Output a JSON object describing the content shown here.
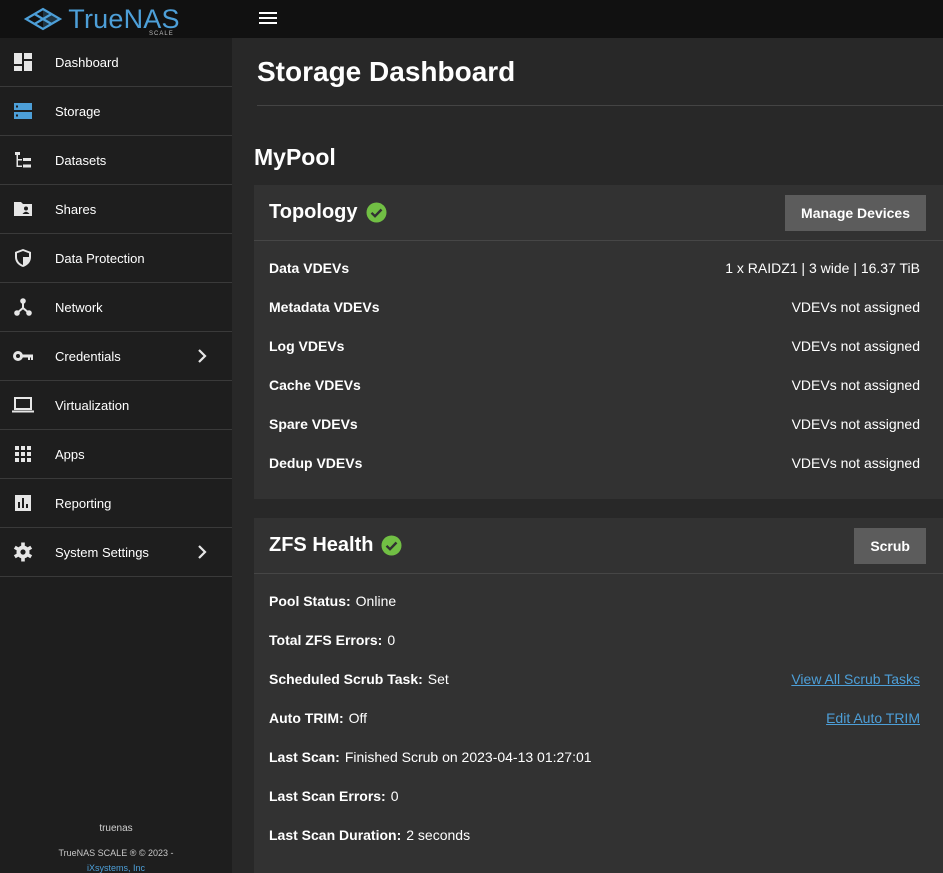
{
  "brand": {
    "name": "TrueNAS",
    "edition": "SCALE"
  },
  "sidebar": {
    "items": [
      {
        "label": "Dashboard",
        "icon": "dashboard-icon"
      },
      {
        "label": "Storage",
        "icon": "storage-icon"
      },
      {
        "label": "Datasets",
        "icon": "datasets-icon"
      },
      {
        "label": "Shares",
        "icon": "shares-folder-icon"
      },
      {
        "label": "Data Protection",
        "icon": "shield-icon"
      },
      {
        "label": "Network",
        "icon": "network-icon"
      },
      {
        "label": "Credentials",
        "icon": "key-icon"
      },
      {
        "label": "Virtualization",
        "icon": "laptop-icon"
      },
      {
        "label": "Apps",
        "icon": "apps-grid-icon"
      },
      {
        "label": "Reporting",
        "icon": "reporting-chart-icon"
      },
      {
        "label": "System Settings",
        "icon": "gear-icon"
      }
    ],
    "footer": {
      "hostname": "truenas",
      "copyright": "TrueNAS SCALE ® © 2023 -",
      "company": "iXsystems, Inc"
    }
  },
  "page": {
    "title": "Storage Dashboard"
  },
  "pool": {
    "name": "MyPool"
  },
  "topology": {
    "title": "Topology",
    "button": "Manage Devices",
    "rows": [
      {
        "label": "Data VDEVs",
        "value": "1 x RAIDZ1 | 3 wide | 16.37 TiB"
      },
      {
        "label": "Metadata VDEVs",
        "value": "VDEVs not assigned"
      },
      {
        "label": "Log VDEVs",
        "value": "VDEVs not assigned"
      },
      {
        "label": "Cache VDEVs",
        "value": "VDEVs not assigned"
      },
      {
        "label": "Spare VDEVs",
        "value": "VDEVs not assigned"
      },
      {
        "label": "Dedup VDEVs",
        "value": "VDEVs not assigned"
      }
    ]
  },
  "zfs": {
    "title": "ZFS Health",
    "button": "Scrub",
    "rows": [
      {
        "label": "Pool Status:",
        "value": "Online"
      },
      {
        "label": "Total ZFS Errors:",
        "value": "0"
      },
      {
        "label": "Scheduled Scrub Task:",
        "value": "Set",
        "link": "View All Scrub Tasks"
      },
      {
        "label": "Auto TRIM:",
        "value": "Off",
        "link": "Edit Auto TRIM"
      },
      {
        "label": "Last Scan:",
        "value": "Finished Scrub on 2023-04-13 01:27:01"
      },
      {
        "label": "Last Scan Errors:",
        "value": "0"
      },
      {
        "label": "Last Scan Duration:",
        "value": "2 seconds"
      }
    ]
  },
  "colors": {
    "accent": "#4d9fd8",
    "success": "#71bf44",
    "sidebar_bg": "#1e1e1e",
    "card_bg": "#323232",
    "topbar_bg": "#111111"
  }
}
